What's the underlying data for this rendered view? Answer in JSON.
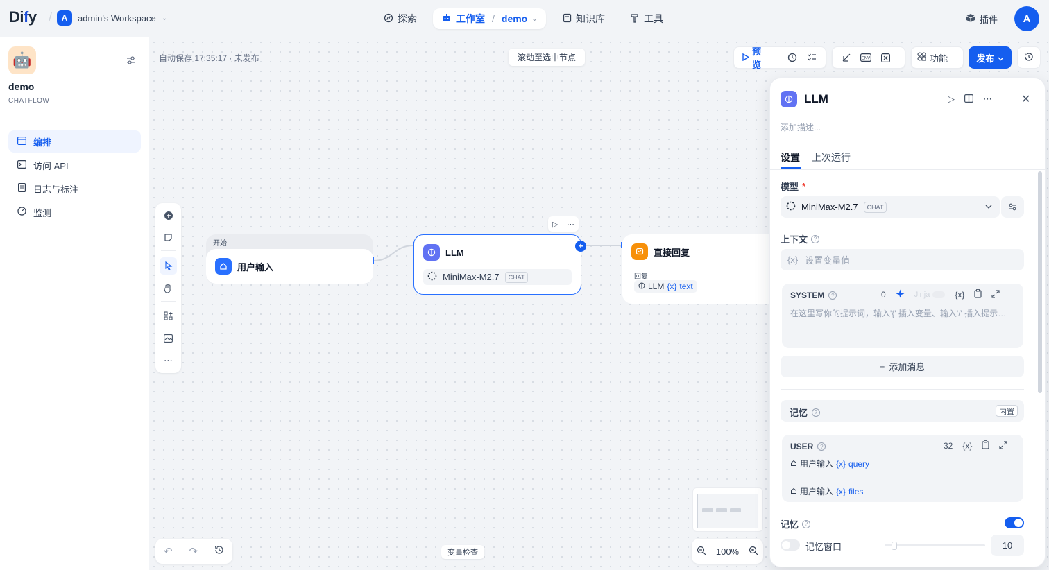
{
  "brand": {
    "logo_text": "Dify"
  },
  "workspace": {
    "avatar": "A",
    "name": "admin's Workspace"
  },
  "nav": {
    "explore": "探索",
    "studio": "工作室",
    "app": "demo",
    "knowledge": "知识库",
    "tools": "工具"
  },
  "header_right": {
    "plugins": "插件",
    "user_avatar": "A"
  },
  "sidebar": {
    "app_name": "demo",
    "app_type": "CHATFLOW",
    "items": [
      {
        "label": "编排",
        "icon": "layout-icon",
        "active": true
      },
      {
        "label": "访问 API",
        "icon": "terminal-icon",
        "active": false
      },
      {
        "label": "日志与标注",
        "icon": "log-icon",
        "active": false
      },
      {
        "label": "监测",
        "icon": "monitor-icon",
        "active": false
      }
    ]
  },
  "canvas": {
    "autosave": "自动保存 17:35:17 · 未发布",
    "scroll_to_selected": "滚动至选中节点",
    "variable_inspect": "变量检查",
    "zoom": "100%"
  },
  "toolbar": {
    "preview": "预览",
    "features": "功能",
    "publish": "发布"
  },
  "nodes": {
    "start": {
      "label": "开始",
      "title": "用户输入"
    },
    "llm": {
      "title": "LLM",
      "model": "MiniMax-M2.7",
      "mode": "CHAT"
    },
    "answer": {
      "title": "直接回复",
      "field_label": "回复",
      "source": "LLM",
      "var": "text"
    }
  },
  "panel": {
    "title": "LLM",
    "description_placeholder": "添加描述...",
    "tabs": [
      "设置",
      "上次运行"
    ],
    "model_label": "模型",
    "model_name": "MiniMax-M2.7",
    "model_mode": "CHAT",
    "context_label": "上下文",
    "context_placeholder": "设置变量值",
    "system": {
      "title": "SYSTEM",
      "count": "0",
      "jinja": "Jinja",
      "placeholder": "在这里写你的提示词，输入'{' 插入变量、输入'/' 插入提示内容块"
    },
    "add_message": "添加消息",
    "memory_section": {
      "label": "记忆",
      "badge": "内置"
    },
    "user": {
      "title": "USER",
      "count": "32",
      "vars": [
        {
          "source": "用户输入",
          "name": "query"
        },
        {
          "source": "用户输入",
          "name": "files"
        }
      ]
    },
    "memory_toggle_label": "记忆",
    "memory_enabled": true,
    "window_label": "记忆窗口",
    "window_enabled": false,
    "window_value": "10"
  },
  "colors": {
    "accent": "#155eef",
    "start_icon": "#2970ff",
    "llm_icon": "#6172f3",
    "answer_icon": "#f79009"
  }
}
